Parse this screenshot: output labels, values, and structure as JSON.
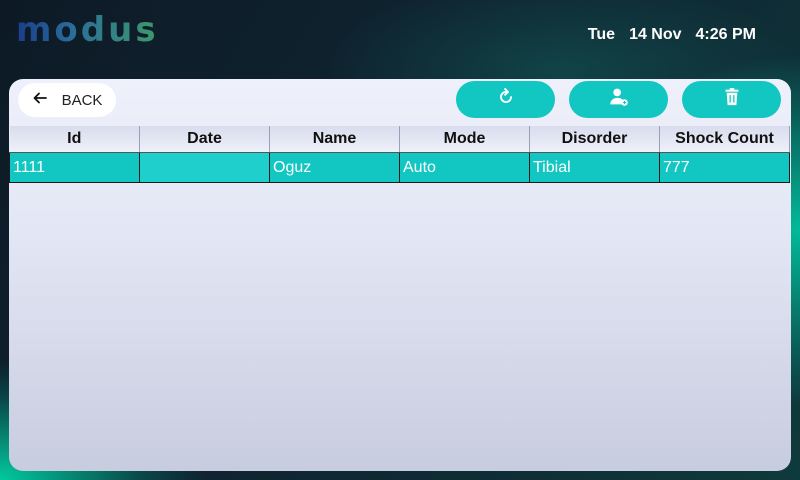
{
  "brand": {
    "name": "modus"
  },
  "header": {
    "day": "Tue",
    "date": "14 Nov",
    "time": "4:26 PM"
  },
  "toolbar": {
    "back_label": "BACK",
    "back_icon": "arrow-left-icon",
    "refresh_icon": "refresh-icon",
    "add_user_icon": "add-user-icon",
    "delete_icon": "trash-icon"
  },
  "table": {
    "columns": [
      "Id",
      "Date",
      "Name",
      "Mode",
      "Disorder",
      "Shock Count"
    ],
    "rows": [
      [
        "1111",
        "",
        "Oguz",
        "Auto",
        "Tibial",
        "777"
      ]
    ]
  },
  "colors": {
    "accent": "#12c7c2",
    "panel": "#e6e8f4"
  }
}
